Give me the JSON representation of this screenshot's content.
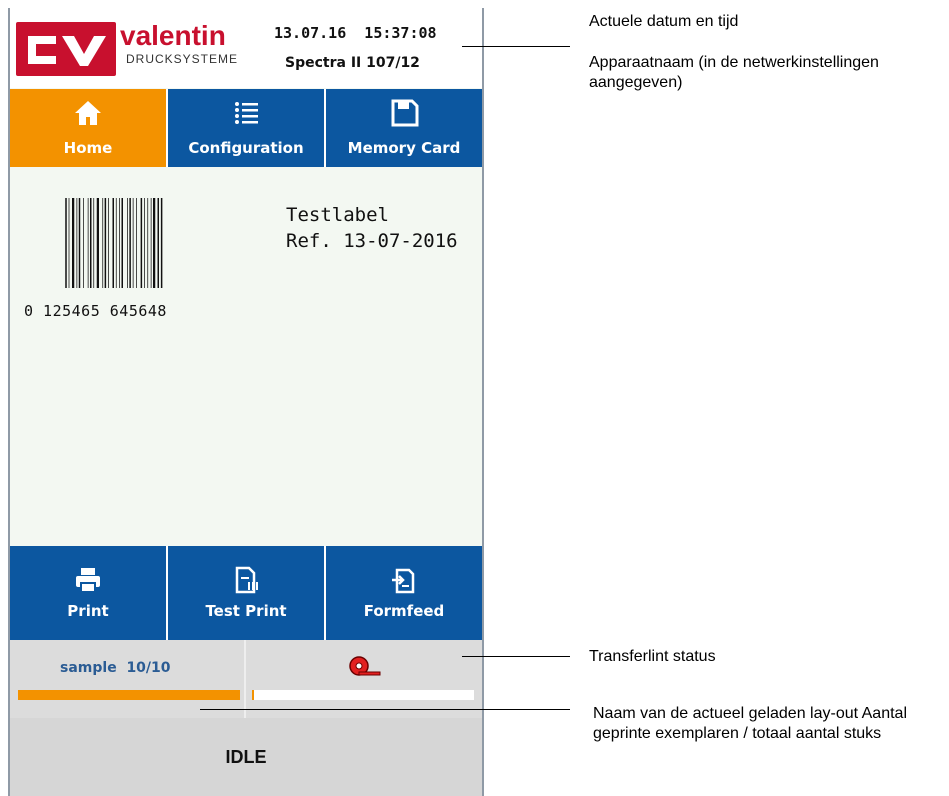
{
  "header": {
    "brand": "valentin",
    "brand_sub": "DRUCKSYSTEME",
    "datetime": "13.07.16  15:37:08",
    "device_name": "Spectra II 107/12"
  },
  "tabs": [
    {
      "label": "Home",
      "icon": "home-icon",
      "active": true
    },
    {
      "label": "Configuration",
      "icon": "list-icon",
      "active": false
    },
    {
      "label": "Memory Card",
      "icon": "save-icon",
      "active": false
    }
  ],
  "preview": {
    "barcode_digits": "0 125465 645648",
    "label_line1": "Testlabel",
    "label_line2": "Ref. 13-07-2016"
  },
  "actions": [
    {
      "label": "Print",
      "icon": "printer-icon"
    },
    {
      "label": "Test Print",
      "icon": "test-print-icon"
    },
    {
      "label": "Formfeed",
      "icon": "formfeed-icon"
    }
  ],
  "status": {
    "layout_name": "sample",
    "printed_count": "10/10",
    "progress": 1.0,
    "ribbon_icon": "ribbon-icon",
    "ribbon_level": 0.01,
    "state": "IDLE"
  },
  "callouts": {
    "datetime": "Actuele datum en tijd",
    "device_name": "Apparaatnaam (in de netwerkinstellingen aangegeven)",
    "ribbon": "Transferlint status",
    "layout": "Naam van de actueel geladen lay-out Aantal geprinte exemplaren / totaal aantal stuks"
  },
  "colors": {
    "brand_red": "#c8102e",
    "tab_blue": "#0c57a0",
    "accent_orange": "#f39200"
  }
}
